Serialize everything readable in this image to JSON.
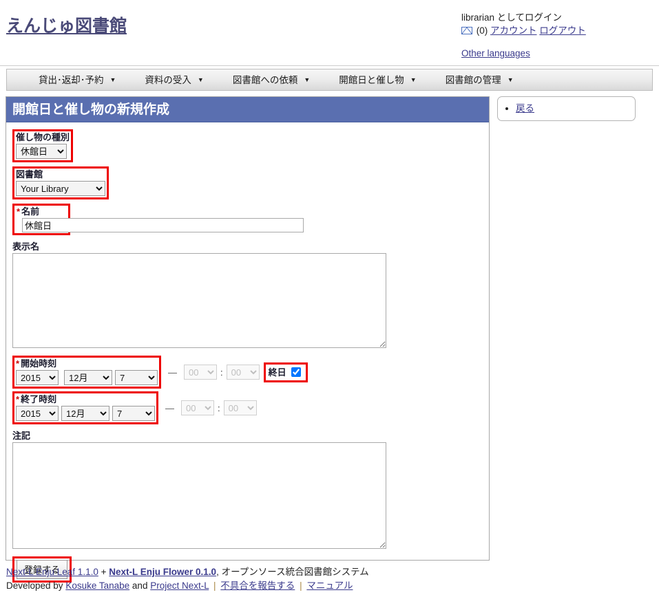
{
  "header": {
    "site_title": "えんじゅ図書館",
    "login_user": "librarian",
    "login_suffix": " としてログイン",
    "mail_icon": "envelope-icon",
    "message_count": "(0)",
    "account_link": "アカウント",
    "logout_link": "ログアウト",
    "other_languages": "Other languages"
  },
  "nav": {
    "items": [
      {
        "label": "貸出･返却･予約",
        "caret": "▼"
      },
      {
        "label": "資料の受入",
        "caret": "▼"
      },
      {
        "label": "図書館への依頼",
        "caret": "▼"
      },
      {
        "label": "開館日と催し物",
        "caret": "▼"
      },
      {
        "label": "図書館の管理",
        "caret": "▼"
      }
    ]
  },
  "page": {
    "title": "開館日と催し物の新規作成",
    "title_bar_color": "#5a6fb0",
    "highlight_color": "#ee0000"
  },
  "form": {
    "event_category": {
      "label": "催し物の種別",
      "value": "休館日",
      "options": [
        "休館日"
      ]
    },
    "library": {
      "label": "図書館",
      "value": "Your Library",
      "options": [
        "Your Library"
      ]
    },
    "name": {
      "label": "名前",
      "required_mark": "*",
      "value": "休館日",
      "placeholder": ""
    },
    "display_name": {
      "label": "表示名",
      "value": "",
      "placeholder": ""
    },
    "start_at": {
      "label": "開始時刻",
      "required_mark": "*",
      "year": "2015",
      "month": "12月",
      "day": "7",
      "hour": "00",
      "minute": "00",
      "dash": "—",
      "colon": ":",
      "all_day": {
        "label": "終日",
        "checked": true
      }
    },
    "end_at": {
      "label": "終了時刻",
      "required_mark": "*",
      "year": "2015",
      "month": "12月",
      "day": "7",
      "hour": "00",
      "minute": "00",
      "dash": "—",
      "colon": ":"
    },
    "note": {
      "label": "注記",
      "value": "",
      "placeholder": ""
    },
    "submit_label": "登録する"
  },
  "sidebar": {
    "items": [
      {
        "label": "戻る"
      }
    ]
  },
  "footer": {
    "leaf": "Next-L Enju Leaf 1.1.0",
    "plus": "+",
    "flower": "Next-L Enju Flower 0.1.0",
    "tagline": ", オープンソース統合図書館システム",
    "developed_by": "Developed by",
    "author": "Kosuke Tanabe",
    "and": "and",
    "project": "Project Next-L",
    "sep1": "|",
    "report_bug": "不具合を報告する",
    "sep2": "|",
    "manual": "マニュアル"
  }
}
